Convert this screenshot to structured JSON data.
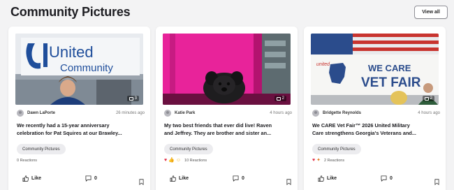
{
  "section": {
    "title": "Community Pictures",
    "view_all_label": "View all"
  },
  "cards": [
    {
      "photo_icon": "photo-count-icon",
      "photo_count": "3",
      "photo_sign_line1": "United",
      "photo_sign_line2": "Community",
      "author": "Dawn LaPorte",
      "time": "26 minutes ago",
      "text_line1": "We recently had a 15-year anniversary",
      "text_line2": "celebration for Pat Squires at our Brawley...",
      "tag": "Community Pictures",
      "reactions_text": "0 Reactions",
      "reaction_icons": [],
      "like_label": "Like",
      "comment_count": "0"
    },
    {
      "photo_icon": "photo-count-icon",
      "photo_count": "2",
      "author": "Katie Park",
      "time": "4 hours ago",
      "text_line1": "My two best friends that ever did live! Raven",
      "text_line2": "and Jeffrey. They are brother and sister an...",
      "tag": "Community Pictures",
      "reactions_text": "10 Reactions",
      "reaction_icons": [
        "heart-icon",
        "thumbs-up-icon",
        "laugh-icon"
      ],
      "like_label": "Like",
      "comment_count": "0"
    },
    {
      "photo_icon": "photo-count-icon",
      "photo_count": "2",
      "photo_sign_line1": "WE CARE",
      "photo_sign_line2": "VET FAIR",
      "photo_sign_small": "united",
      "author": "Bridgette Reynolds",
      "time": "4 hours ago",
      "text_line1": "We CARE Vet Fair™ 2026 United Military",
      "text_line2": "Care strengthens Georgia's Veterans and...",
      "tag": "Community Pictures",
      "reactions_text": "2 Reactions",
      "reaction_icons": [
        "heart-icon",
        "party-icon"
      ],
      "like_label": "Like",
      "comment_count": "0"
    }
  ],
  "colors": {
    "background": "#f3f3f4",
    "card": "#ffffff",
    "tag_bg": "#ececef",
    "heart": "#e0314a",
    "brand_blue": "#1f4e9b",
    "pink_chair": "#e8239a"
  }
}
